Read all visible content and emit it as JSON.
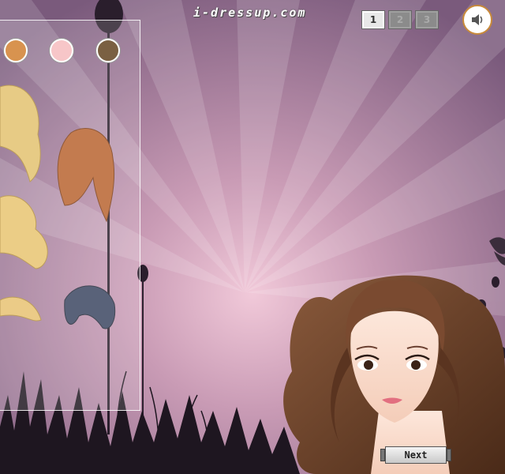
{
  "header": {
    "site_title": "i-dressup.com"
  },
  "pager": {
    "pages": [
      "1",
      "2",
      "3"
    ],
    "active_page": "1"
  },
  "sound": {
    "icon": "speaker-icon"
  },
  "panel": {
    "swatches": [
      {
        "name": "hair-color-orange",
        "color": "#d8934f"
      },
      {
        "name": "hair-color-pink",
        "color": "#f7c6c8"
      },
      {
        "name": "hair-color-brown",
        "color": "#7a6042"
      }
    ],
    "hairstyles": [
      "blonde-long-wavy",
      "auburn-long-bangs",
      "blonde-curly",
      "blonde-short-updo",
      "blue-black-bob"
    ]
  },
  "nav": {
    "next_label": "Next"
  },
  "colors": {
    "background": "#8a6a8a",
    "ray_light": "#c29ab5",
    "accent": "#c98a3a"
  }
}
